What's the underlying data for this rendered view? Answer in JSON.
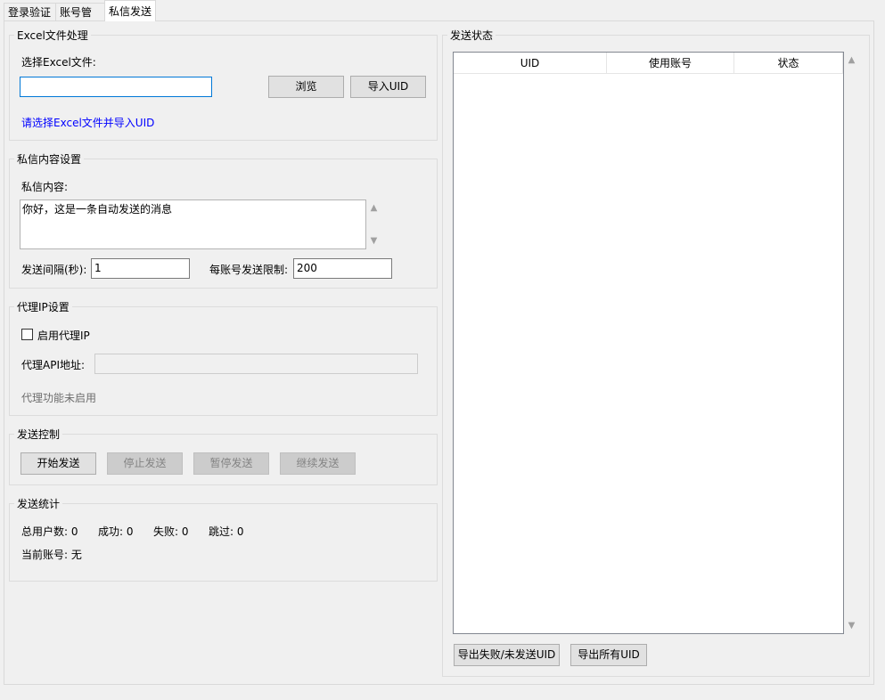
{
  "tabs": [
    {
      "label": "登录验证",
      "active": false
    },
    {
      "label": "账号管理",
      "active": false
    },
    {
      "label": "私信发送",
      "active": true
    }
  ],
  "excel_group": {
    "title": "Excel文件处理",
    "select_label": "选择Excel文件:",
    "file_value": "",
    "browse_label": "浏览",
    "import_label": "导入UID",
    "hint": "请选择Excel文件并导入UID"
  },
  "message_group": {
    "title": "私信内容设置",
    "content_label": "私信内容:",
    "content_value": "你好，这是一条自动发送的消息",
    "interval_label": "发送间隔(秒):",
    "interval_value": "1",
    "limit_label": "每账号发送限制:",
    "limit_value": "200"
  },
  "proxy_group": {
    "title": "代理IP设置",
    "enable_label": "启用代理IP",
    "enabled": false,
    "api_label": "代理API地址:",
    "api_value": "",
    "status_text": "代理功能未启用"
  },
  "control_group": {
    "title": "发送控制",
    "start_label": "开始发送",
    "stop_label": "停止发送",
    "pause_label": "暂停发送",
    "resume_label": "继续发送"
  },
  "stats_group": {
    "title": "发送统计",
    "total": "总用户数: 0",
    "success": "成功: 0",
    "failed": "失败: 0",
    "skipped": "跳过: 0",
    "current_account": "当前账号: 无"
  },
  "status_group": {
    "title": "发送状态",
    "columns": [
      "UID",
      "使用账号",
      "状态"
    ],
    "rows": [],
    "export_failed_label": "导出失败/未发送UID",
    "export_all_label": "导出所有UID"
  },
  "colors": {
    "link": "#0000ff",
    "focus_border": "#0078d7",
    "disabled_text": "#838383"
  }
}
